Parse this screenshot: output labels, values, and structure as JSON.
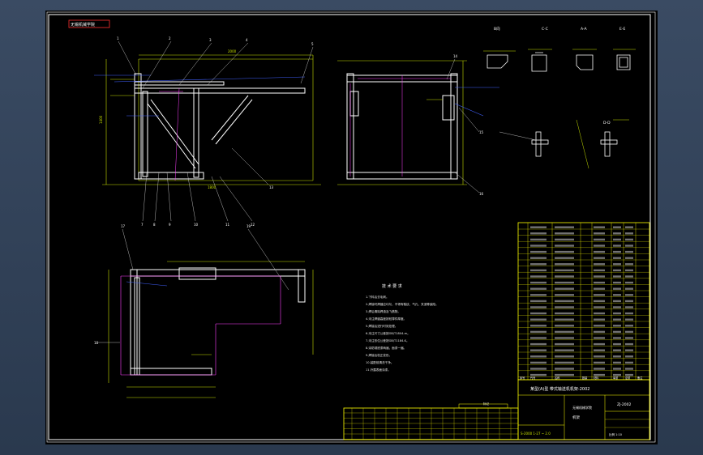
{
  "drawing": {
    "title_tab": "无锡机械学院",
    "section_labels": [
      "B向",
      "C-C",
      "A-A",
      "E-E",
      "D-D"
    ],
    "notes_title": "技 术 要 求",
    "notes": [
      "1.下料后去毛刺。",
      "2.焊接时焊缝应均匀，不得有裂纹、气孔、夹渣等缺陷。",
      "3.焊后清除焊渣及飞溅物。",
      "4.未注焊缝高度按较薄件厚度。",
      "5.焊接后进行时效处理。",
      "6.未注尺寸公差按GB/T1804-m。",
      "7.未注形位公差按GB/T1184-K。",
      "8.涂防锈底漆两遍，面漆一遍。",
      "9.焊接后校正变形。",
      "10.装配前清洗干净。",
      "11.外露表面涂漆。"
    ],
    "title_block": {
      "main_title": "某型(A)型 带式输送机机架-2002",
      "drawing_no": "ZJ-2002",
      "part_name": "机架",
      "scale_text": "比例 1:10",
      "unit": "无锡机械学院",
      "bottom_code": "S-2000 1-27 ~ 2.0"
    },
    "bom_headers": [
      "序号",
      "代号",
      "名称",
      "数量",
      "材料",
      "单重",
      "总重",
      "备注"
    ],
    "rev_header": "标记"
  }
}
